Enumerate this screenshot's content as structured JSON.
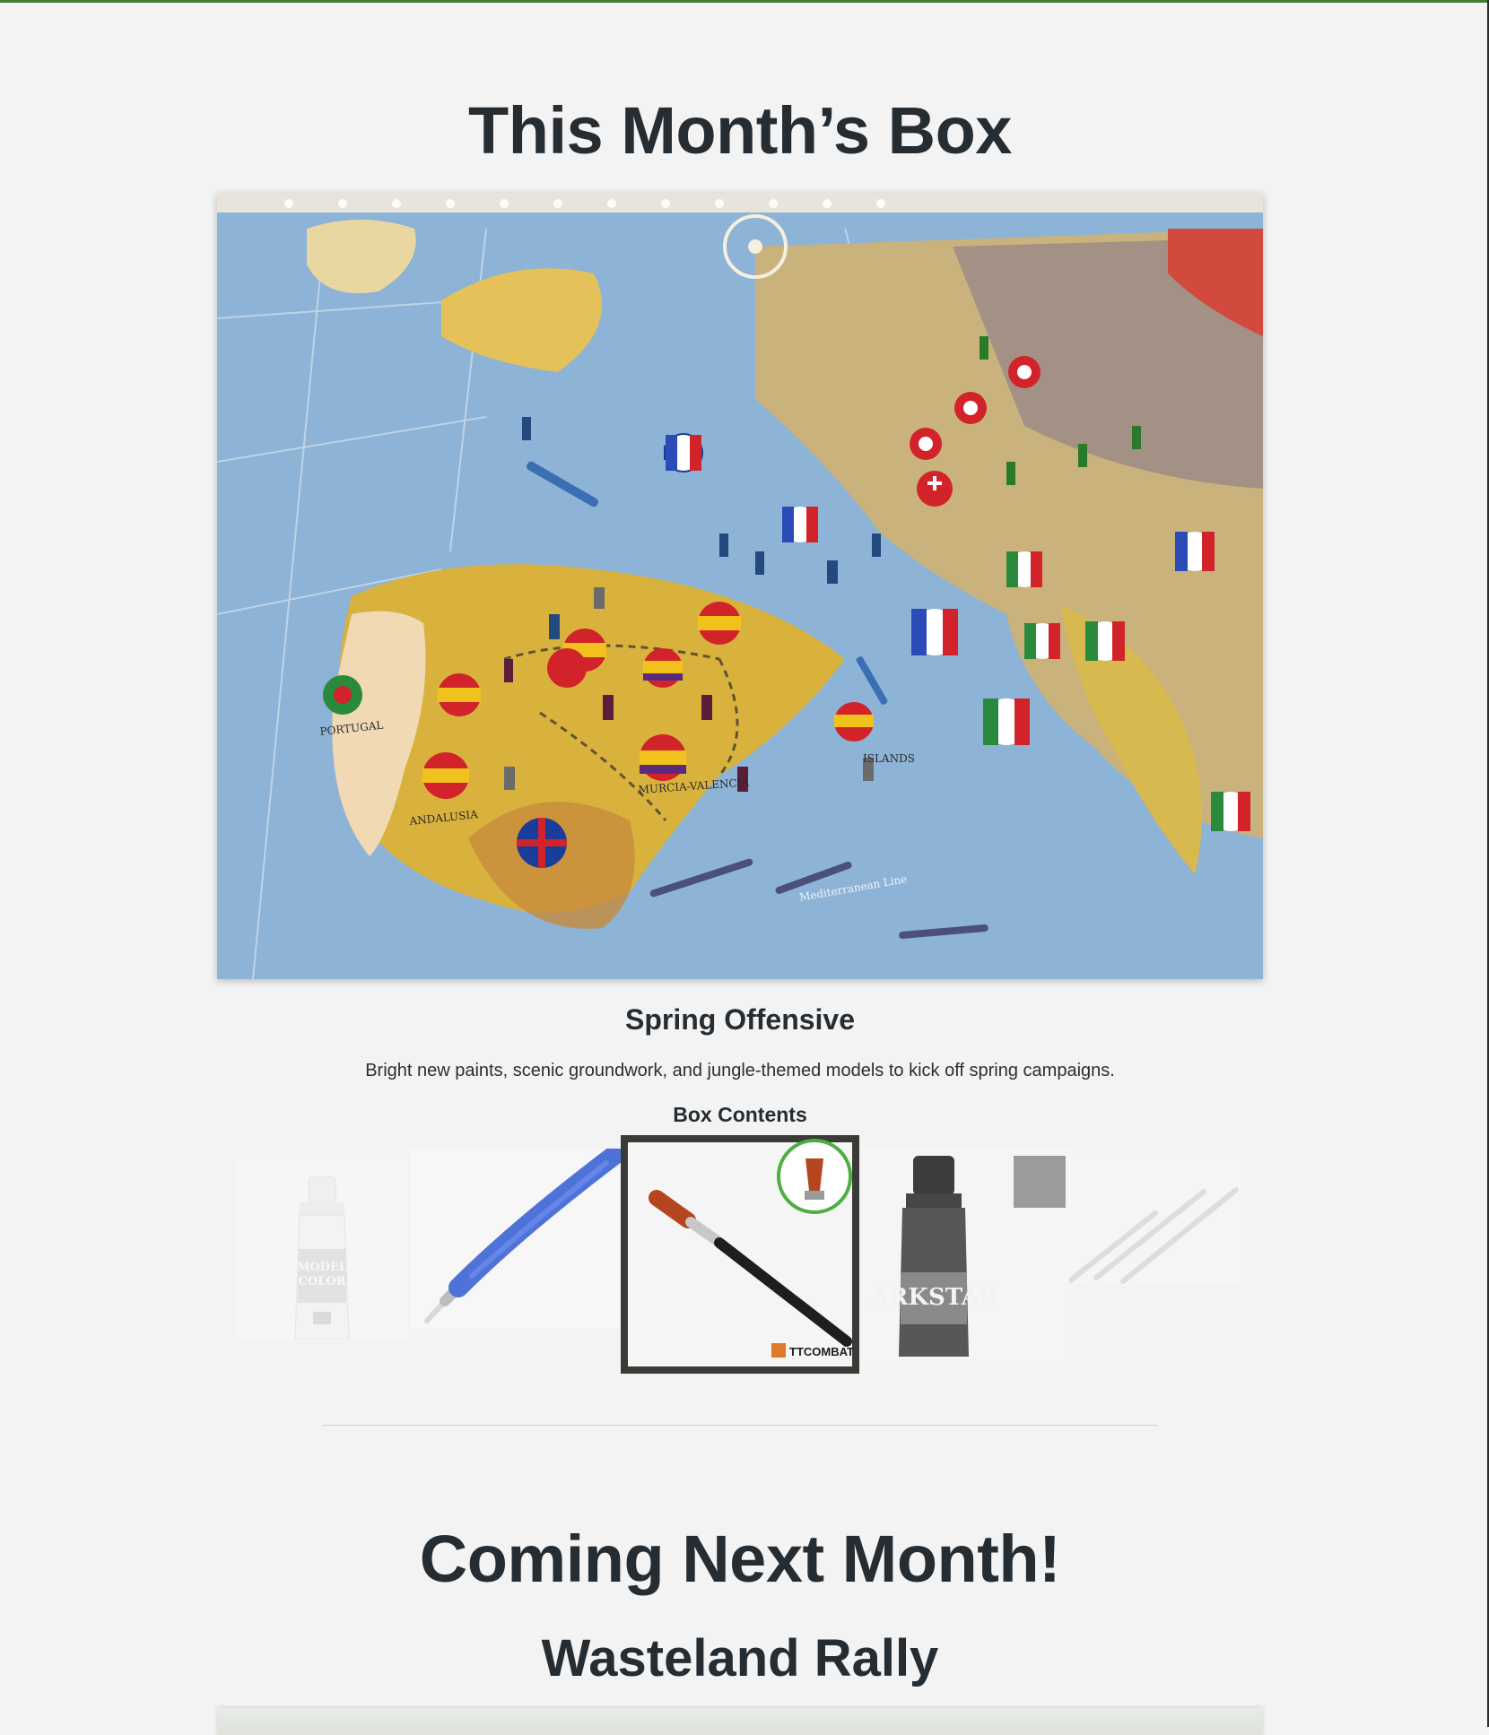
{
  "current_box": {
    "section_title": "This Month’s Box",
    "name": "Spring Offensive",
    "description": "Bright new paints, scenic groundwork, and jungle-themed models to kick off spring campaigns.",
    "contents_label": "Box Contents",
    "contents": [
      {
        "item": "white paint bottle",
        "icon": "paint-bottle-icon",
        "label_lines": [
          "MODEL",
          "COLOR"
        ]
      },
      {
        "item": "blue hobby knife",
        "icon": "hobby-knife-icon"
      },
      {
        "item": "flat paint brush",
        "icon": "paint-brush-icon",
        "brand": "TTCOMBAT",
        "selected": true
      },
      {
        "item": "grey metallic paint",
        "icon": "paint-bottle-icon",
        "label": "ARKSTAR"
      },
      {
        "item": "sculpting tools",
        "icon": "sculpt-tools-icon"
      }
    ]
  },
  "next_box": {
    "section_title": "Coming Next Month!",
    "name": "Wasteland Rally"
  },
  "colors": {
    "accent": "#3f7a2f",
    "background": "#f3f3f3",
    "text": "#252d33",
    "highlight_ring": "#4caf3f"
  }
}
